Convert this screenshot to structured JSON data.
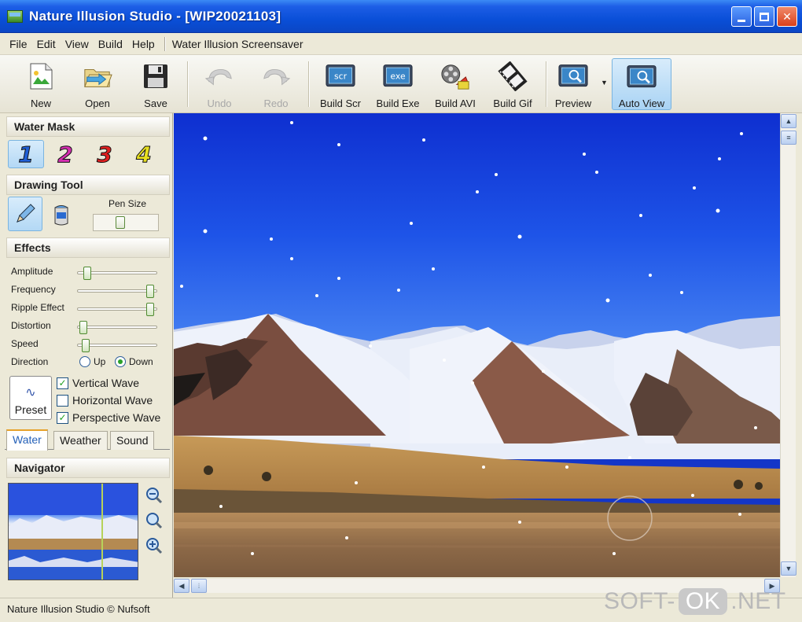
{
  "window": {
    "title": "Nature Illusion Studio - [WIP20021103]"
  },
  "menu": {
    "items": [
      "File",
      "Edit",
      "View",
      "Build",
      "Help"
    ],
    "extra": "Water Illusion Screensaver"
  },
  "toolbar": {
    "new": "New",
    "open": "Open",
    "save": "Save",
    "undo": "Undo",
    "redo": "Redo",
    "build_scr": "Build Scr",
    "build_exe": "Build Exe",
    "build_avi": "Build AVI",
    "build_gif": "Build Gif",
    "preview": "Preview",
    "auto_view": "Auto View",
    "scr_icon_text": "scr",
    "exe_icon_text": "exe"
  },
  "water_mask": {
    "title": "Water Mask",
    "masks": [
      "1",
      "2",
      "3",
      "4"
    ],
    "selected": 1
  },
  "drawing_tool": {
    "title": "Drawing Tool",
    "pen_size_label": "Pen Size",
    "pen_size": 0.4
  },
  "effects": {
    "title": "Effects",
    "sliders": [
      {
        "label": "Amplitude",
        "value": 0.08
      },
      {
        "label": "Frequency",
        "value": 0.97
      },
      {
        "label": "Ripple Effect",
        "value": 0.97
      },
      {
        "label": "Distortion",
        "value": 0.02
      },
      {
        "label": "Speed",
        "value": 0.06
      }
    ],
    "direction_label": "Direction",
    "direction_up": "Up",
    "direction_down": "Down",
    "direction_selected": "Down",
    "preset": "Preset",
    "checks": [
      {
        "label": "Vertical Wave",
        "checked": true
      },
      {
        "label": "Horizontal Wave",
        "checked": false
      },
      {
        "label": "Perspective Wave",
        "checked": true
      }
    ],
    "check_mark": "✓"
  },
  "tabs": {
    "water": "Water",
    "weather": "Weather",
    "sound": "Sound",
    "active": "Water"
  },
  "navigator": {
    "title": "Navigator"
  },
  "status": {
    "text": "Nature Illusion Studio © Nufsoft"
  },
  "watermark": {
    "left": "SOFT-",
    "ok": "OK",
    "right": ".NET"
  },
  "colors": {
    "mask1": "#1f5fd6",
    "mask2": "#d42fb0",
    "mask3": "#e02020",
    "mask4": "#e8e020",
    "title_bar": "#0a4fd8"
  }
}
